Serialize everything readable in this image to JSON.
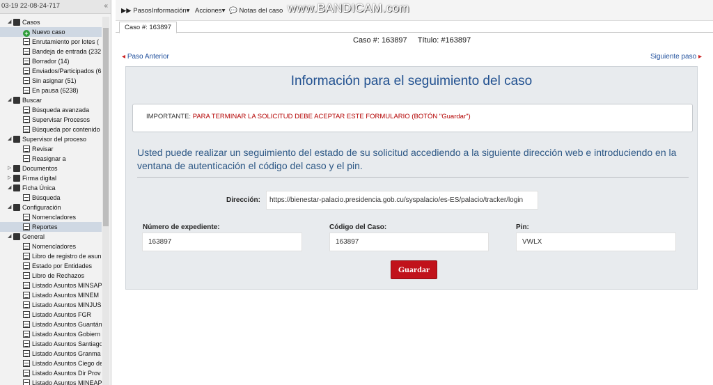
{
  "sidebar": {
    "timestamp": "03-19 22-08-24-717",
    "items": [
      {
        "label": "Casos",
        "level": 1,
        "icon": "folder-icon",
        "arrow": "▲"
      },
      {
        "label": "Nuevo caso",
        "level": 2,
        "icon": "add-icon",
        "selected": true
      },
      {
        "label": "Enrutamiento por lotes (",
        "level": 2,
        "icon": "doc-icon"
      },
      {
        "label": "Bandeja de entrada (232",
        "level": 2,
        "icon": "inbox-icon"
      },
      {
        "label": "Borrador (14)",
        "level": 2,
        "icon": "pencil-icon"
      },
      {
        "label": "Enviados/Participados (6",
        "level": 2,
        "icon": "sent-icon"
      },
      {
        "label": "Sin asignar (51)",
        "level": 2,
        "icon": "refresh-icon"
      },
      {
        "label": "En pausa (6238)",
        "level": 2,
        "icon": "pause-icon"
      },
      {
        "label": "Buscar",
        "level": 1,
        "icon": "binoculars-icon",
        "arrow": "▲"
      },
      {
        "label": "Búsqueda avanzada",
        "level": 2,
        "icon": "search-doc-icon"
      },
      {
        "label": "Supervisar Procesos",
        "level": 2,
        "icon": "list-icon"
      },
      {
        "label": "Búsqueda por contenido",
        "level": 2,
        "icon": "list-icon"
      },
      {
        "label": "Supervisor del proceso",
        "level": 1,
        "icon": "user-icon",
        "arrow": "▲"
      },
      {
        "label": "Revisar",
        "level": 2,
        "icon": "doc-icon"
      },
      {
        "label": "Reasignar a",
        "level": 2,
        "icon": "refresh-icon"
      },
      {
        "label": "Documentos",
        "level": 1,
        "icon": "book-icon",
        "arrow": "▶"
      },
      {
        "label": "Firma digital",
        "level": 1,
        "icon": "folder-icon",
        "arrow": "▶"
      },
      {
        "label": "Ficha Única",
        "level": 1,
        "icon": "folder-icon",
        "arrow": "▲"
      },
      {
        "label": "Búsqueda",
        "level": 2,
        "icon": "list-icon"
      },
      {
        "label": "Configuración",
        "level": 1,
        "icon": "folder-icon",
        "arrow": "▲"
      },
      {
        "label": "Nomencladores",
        "level": 2,
        "icon": "list-icon"
      },
      {
        "label": "Reportes",
        "level": 2,
        "icon": "list-icon",
        "highlight": true
      },
      {
        "label": "General",
        "level": 1,
        "icon": "folder-icon",
        "arrow": "▲"
      },
      {
        "label": "Nomencladores",
        "level": 2,
        "icon": "list-icon"
      },
      {
        "label": "Libro de registro de asun",
        "level": 2,
        "icon": "list-icon"
      },
      {
        "label": "Estado por Entidades",
        "level": 2,
        "icon": "list-icon"
      },
      {
        "label": "Libro de Rechazos",
        "level": 2,
        "icon": "list-icon"
      },
      {
        "label": "Listado Asuntos MINSAP",
        "level": 2,
        "icon": "list-icon"
      },
      {
        "label": "Listado Asuntos MINEM",
        "level": 2,
        "icon": "list-icon"
      },
      {
        "label": "Listado Asuntos MINJUS",
        "level": 2,
        "icon": "list-icon"
      },
      {
        "label": "Listado Asuntos FGR",
        "level": 2,
        "icon": "list-icon"
      },
      {
        "label": "Listado Asuntos Guantán",
        "level": 2,
        "icon": "list-icon"
      },
      {
        "label": "Listado Asuntos Gobiern",
        "level": 2,
        "icon": "list-icon"
      },
      {
        "label": "Listado Asuntos Santiago",
        "level": 2,
        "icon": "list-icon"
      },
      {
        "label": "Listado Asuntos Granma",
        "level": 2,
        "icon": "list-icon"
      },
      {
        "label": "Listado Asuntos Ciego de",
        "level": 2,
        "icon": "list-icon"
      },
      {
        "label": "Listado Asuntos Dir Prov",
        "level": 2,
        "icon": "list-icon"
      },
      {
        "label": "Listado Asuntos MINEAP",
        "level": 2,
        "icon": "list-icon"
      }
    ]
  },
  "toolbar": {
    "pasos": "Pasos",
    "informacion": "Información",
    "acciones": "Acciones",
    "notas": "Notas del caso"
  },
  "watermark": "www.BANDICAM.com",
  "tab": "Caso #: 163897",
  "case_header": "Caso #: 163897     Título: #163897",
  "nav": {
    "prev": "Paso Anterior",
    "next": "Siguiente paso"
  },
  "form": {
    "title": "Información para el seguimiento del caso",
    "important_label": "IMPORTANTE: ",
    "important_msg": "PARA TERMINAR LA SOLICITUD DEBE ACEPTAR ESTE FORMULARIO (BOTÓN \"Guardar\")",
    "info": "Usted puede realizar un seguimiento del estado de su solicitud accediendo a la siguiente dirección web e introduciendo en la ventana de autenticación el código del caso y el pin.",
    "direccion_label": "Dirección:",
    "direccion_value": "https://bienestar-palacio.presidencia.gob.cu/syspalacio/es-ES/palacio/tracker/login",
    "expediente_label": "Número de expediente:",
    "expediente_value": "163897",
    "codigo_label": "Código del Caso:",
    "codigo_value": "163897",
    "pin_label": "Pin:",
    "pin_value": "VWLX",
    "save": "Guardar"
  }
}
